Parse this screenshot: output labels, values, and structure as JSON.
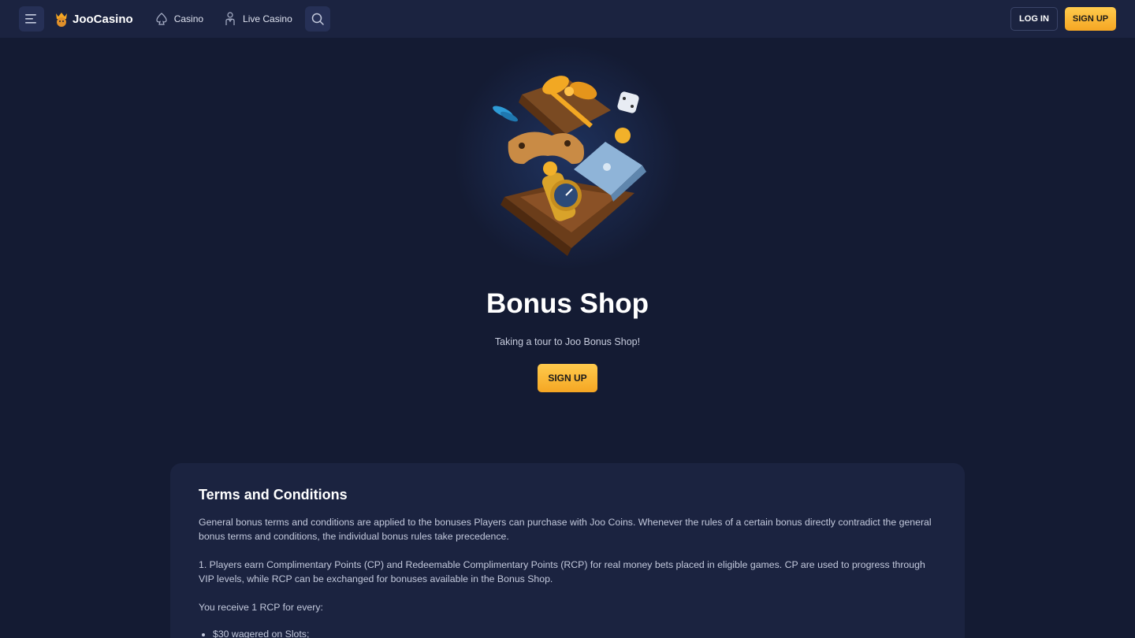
{
  "header": {
    "logo_text": "JooCasino",
    "nav": [
      {
        "label": "Casino",
        "icon": "spade-icon"
      },
      {
        "label": "Live Casino",
        "icon": "dealer-icon"
      }
    ],
    "login_label": "LOG IN",
    "signup_label": "SIGN UP"
  },
  "hero": {
    "title": "Bonus Shop",
    "subtitle": "Taking a tour to Joo Bonus Shop!",
    "signup_label": "SIGN UP"
  },
  "terms": {
    "title": "Terms and Conditions",
    "paragraphs": [
      "General bonus terms and conditions are applied to the bonuses Players can purchase with Joo Coins. Whenever the rules of a certain bonus directly contradict the general bonus terms and conditions, the individual bonus rules take precedence.",
      "1. Players earn Complimentary Points (CP) and Redeemable Complimentary Points (RCP) for real money bets placed in eligible games. CP are used to progress through VIP levels, while RCP can be exchanged for bonuses available in the Bonus Shop.",
      "You receive 1 RCP for every:"
    ],
    "list": [
      "$30 wagered on Slots;"
    ]
  },
  "colors": {
    "background": "#141b33",
    "header_bg": "#1b2340",
    "accent": "#f5a623",
    "card_bg": "#1b2340"
  }
}
